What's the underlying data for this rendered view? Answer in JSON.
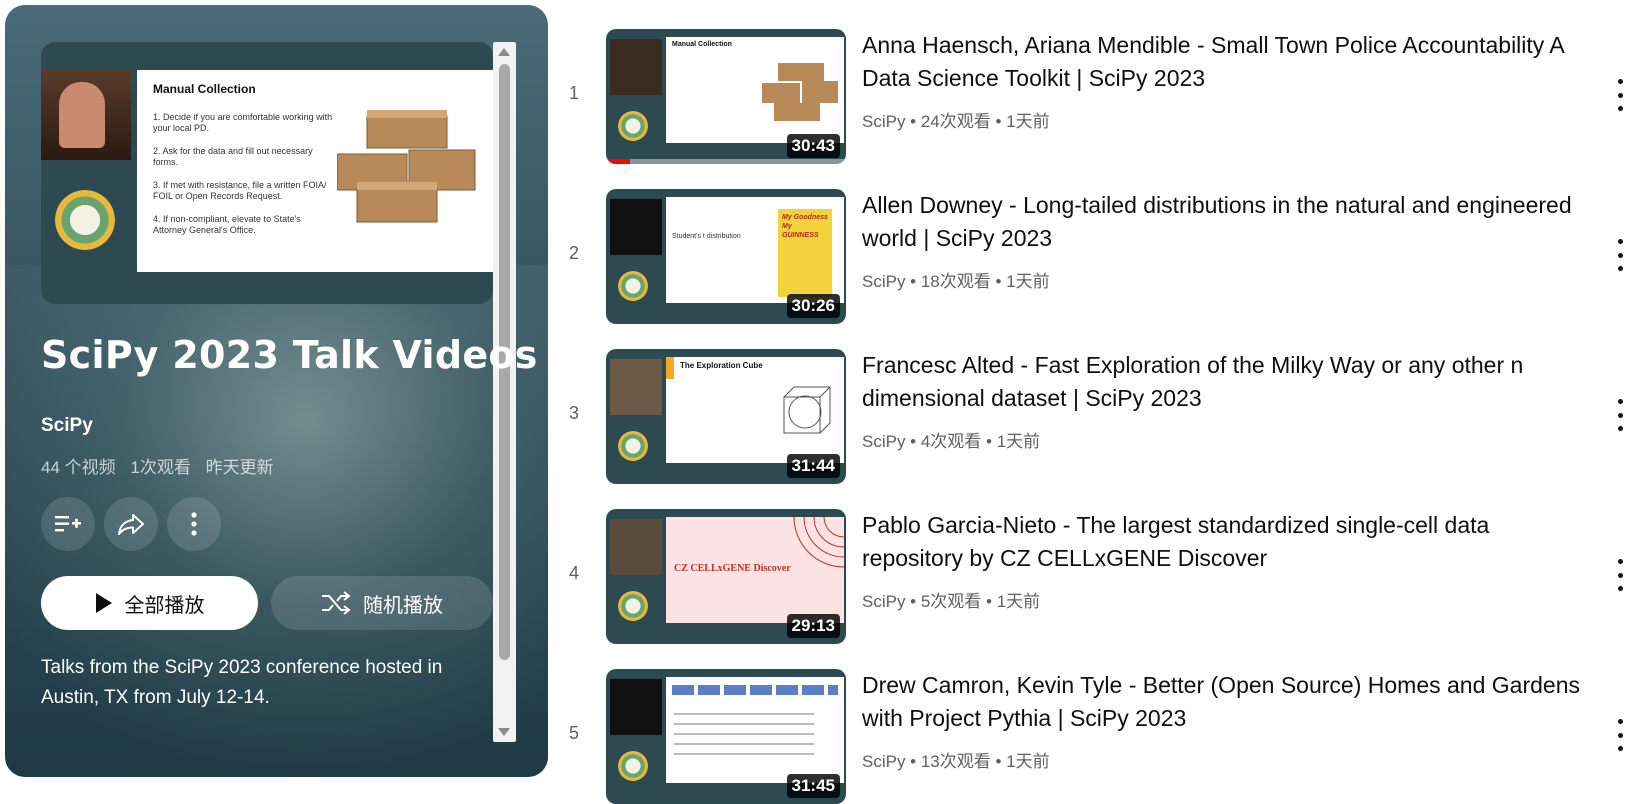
{
  "playlist": {
    "title": "SciPy 2023 Talk Videos",
    "owner": "SciPy",
    "video_count": "44 个视频",
    "views": "1次观看",
    "updated": "昨天更新",
    "play_all_label": "全部播放",
    "shuffle_label": "随机播放",
    "description": "Talks from the SciPy 2023 conference hosted in Austin, TX from July 12-14.",
    "hero_slide": {
      "title": "Manual Collection",
      "bullets": [
        "1. Decide if you are comfortable working with your local PD.",
        "2. Ask for the data and fill out necessary forms.",
        "3. If met with resistance, file a written FOIA/ FOIL or Open Records Request.",
        "4. If non-compliant, elevate to State's Attorney General's Office."
      ]
    },
    "icons": {
      "save": "playlist-add-icon",
      "share": "share-icon",
      "more": "more-vert-icon",
      "play": "play-icon",
      "shuffle": "shuffle-icon"
    }
  },
  "videos": [
    {
      "index": "1",
      "title": "Anna Haensch, Ariana Mendible - Small Town Police Accountability A Data Science Toolkit | SciPy 2023",
      "meta": "SciPy • 24次观看 • 1天前",
      "duration": "30:43",
      "watched_fraction": 0.1,
      "slide_color": "#ffffff"
    },
    {
      "index": "2",
      "title": "Allen Downey - Long-tailed distributions in the natural and engineered world | SciPy 2023",
      "meta": "SciPy • 18次观看 • 1天前",
      "duration": "30:26",
      "watched_fraction": 0,
      "slide_color": "#ffffff"
    },
    {
      "index": "3",
      "title": "Francesc Alted - Fast Exploration of the Milky Way or any other n dimensional dataset | SciPy 2023",
      "meta": "SciPy • 4次观看 • 1天前",
      "duration": "31:44",
      "watched_fraction": 0,
      "slide_color": "#ffffff"
    },
    {
      "index": "4",
      "title": "Pablo Garcia-Nieto - The largest standardized single-cell data repository by CZ CELLxGENE Discover",
      "meta": "SciPy • 5次观看 • 1天前",
      "duration": "29:13",
      "watched_fraction": 0,
      "slide_color": "#fbe3e3"
    },
    {
      "index": "5",
      "title": "Drew Camron, Kevin Tyle - Better (Open Source) Homes and Gardens with Project Pythia | SciPy 2023",
      "meta": "SciPy • 13次观看 • 1天前",
      "duration": "31:45",
      "watched_fraction": 0,
      "slide_color": "#ffffff"
    }
  ],
  "thumb_texts": {
    "v2_slide": "Student's t distribution",
    "v2_book": "My Goodness My GUINNESS",
    "v3_slide": "The Exploration Cube",
    "v4_slide": "CZ CELLxGENE Discover"
  }
}
